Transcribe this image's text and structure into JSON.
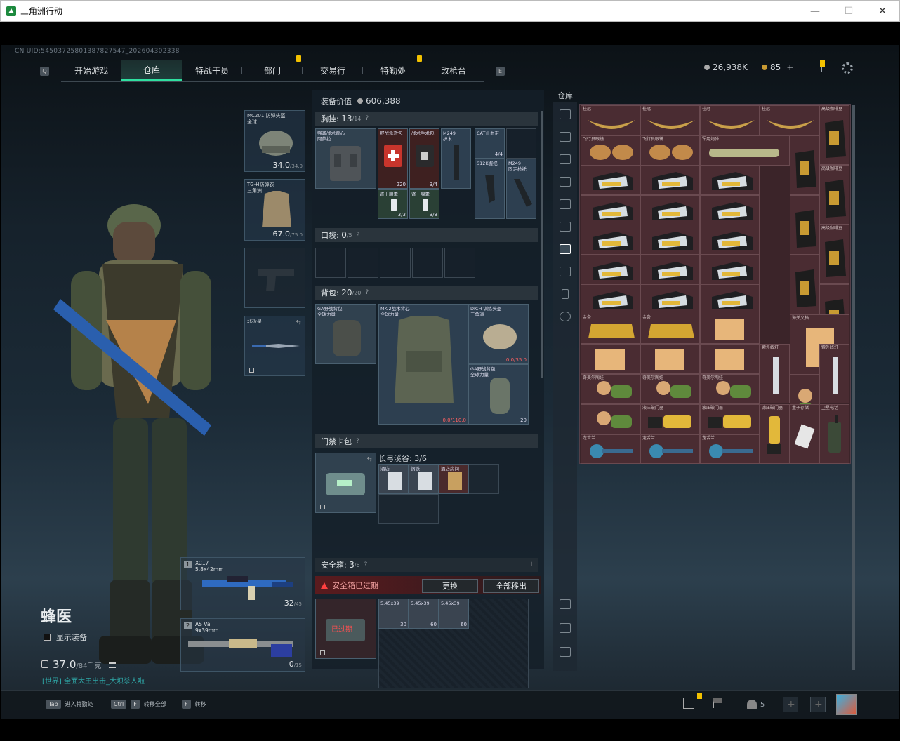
{
  "window": {
    "title": "三角洲行动",
    "minimize": "—",
    "maximize": "☐",
    "close": "✕"
  },
  "uid": "CN UID:54503725801387827547_202604302338",
  "nav": {
    "q_key": "Q",
    "e_key": "E",
    "tabs": [
      "开始游戏",
      "仓库",
      "特战干员",
      "部门",
      "交易行",
      "特勤处",
      "改枪台"
    ],
    "active_tab": "仓库"
  },
  "resources": {
    "silver": "26,938K",
    "gold": "85",
    "plus": "+"
  },
  "operator": {
    "name": "蜂医",
    "show_equipment": "显示装备",
    "weight_value": "37.0",
    "weight_max": "/84千克",
    "chat": "[世界] 全面大王出击_大坝杀人啦"
  },
  "equip_slots": {
    "helmet": {
      "label": "MC201 防弹头盔\n全球",
      "durability": "34.0",
      "max": "/34.0"
    },
    "armor": {
      "label": "TG-H防弹衣\n三角洲",
      "durability": "67.0",
      "max": "/75.0"
    },
    "melee": {
      "label": "北极星"
    }
  },
  "weapons": [
    {
      "num": "1",
      "name": "XC17\n5.8x42mm",
      "ammo": "32",
      "max": "/45"
    },
    {
      "num": "2",
      "name": "AS Val\n9x39mm",
      "ammo": "0",
      "max": "/15"
    }
  ],
  "center": {
    "equip_value_label": "装备价值",
    "equip_value": "606,388",
    "chest": {
      "title": "胸挂:",
      "count": "13",
      "max": "/14"
    },
    "chest_items": [
      {
        "label": "强袭战术背心\n阿萨拉",
        "count": ""
      },
      {
        "label": "野战急救包",
        "count": "220"
      },
      {
        "label": "战术手术包",
        "count": "3/4"
      },
      {
        "label": "M249\n护木",
        "count": ""
      },
      {
        "label": "CAT止血带",
        "count": "4/4"
      },
      {
        "label": "S12K握把",
        "count": ""
      },
      {
        "label": "M249\n固定枪托",
        "count": ""
      },
      {
        "label": "肾上腺素",
        "count": "3/3"
      },
      {
        "label": "肾上腺素",
        "count": "3/3"
      }
    ],
    "pocket": {
      "title": "口袋:",
      "count": "0",
      "max": "/5"
    },
    "backpack": {
      "title": "背包:",
      "count": "20",
      "max": "/20"
    },
    "backpack_items": [
      {
        "label": "GA野战背包\n全球力量",
        "count": ""
      },
      {
        "label": "MK-2战术背心\n全球力量",
        "count": "0.0/110.0"
      },
      {
        "label": "DICH 训练头盔\n三角洲",
        "count": "0.0/35.0"
      },
      {
        "label": "GA野战背包\n全球力量",
        "count": "20"
      }
    ],
    "keycard": {
      "title": "门禁卡包",
      "area": "长弓溪谷: 3/6",
      "key_labels": [
        "酒店",
        "钢铁",
        "酒店房间"
      ]
    },
    "safebox": {
      "title": "安全箱:",
      "count": "3",
      "max": "/6",
      "expired": "安全箱已过期",
      "replace": "更换",
      "move_all": "全部移出",
      "overlay": "已过期",
      "ammo_labels": [
        "5.45x39",
        "5.45x39",
        "5.45x39"
      ],
      "ammo_counts": [
        "30",
        "60",
        "60"
      ]
    }
  },
  "stash": {
    "title": "仓库",
    "items": [
      {
        "label": "桂冠"
      },
      {
        "label": "桂冠"
      },
      {
        "label": "桂冠"
      },
      {
        "label": "桂冠"
      },
      {
        "label": "高级咖啡豆"
      },
      {
        "label": "飞行员眼镜"
      },
      {
        "label": "飞行员眼镜"
      },
      {
        "label": "军用炮弹"
      },
      {
        "label": "高级咖啡豆"
      },
      {
        "label": "高级咖啡豆"
      },
      {
        "label": "金条"
      },
      {
        "label": "金条"
      },
      {
        "label": "海关文档"
      },
      {
        "label": "紫外线灯"
      },
      {
        "label": "紫外线灯"
      },
      {
        "label": "奇美尔陶娃"
      },
      {
        "label": "奇美尔陶娃"
      },
      {
        "label": "奇美尔陶娃"
      },
      {
        "label": "液压破门器"
      },
      {
        "label": "液压破门器"
      },
      {
        "label": "液压破门器"
      },
      {
        "label": "滤压破门器"
      },
      {
        "label": "量子存储"
      },
      {
        "label": "卫星电话"
      },
      {
        "label": "龙舌兰"
      },
      {
        "label": "龙舌兰"
      },
      {
        "label": "龙舌兰"
      }
    ]
  },
  "bottom": {
    "tab_key": "Tab",
    "tab_label": "进入特勤处",
    "ctrl_key": "Ctrl",
    "f_key1": "F",
    "ctrl_label": "转移全部",
    "f_key": "F",
    "f_label": "转移",
    "squad_count": "5"
  },
  "colors": {
    "accent": "#2fe0a0",
    "notif": "#f2c100",
    "stash_bg": "#3b2429",
    "warn": "#ff4040"
  }
}
